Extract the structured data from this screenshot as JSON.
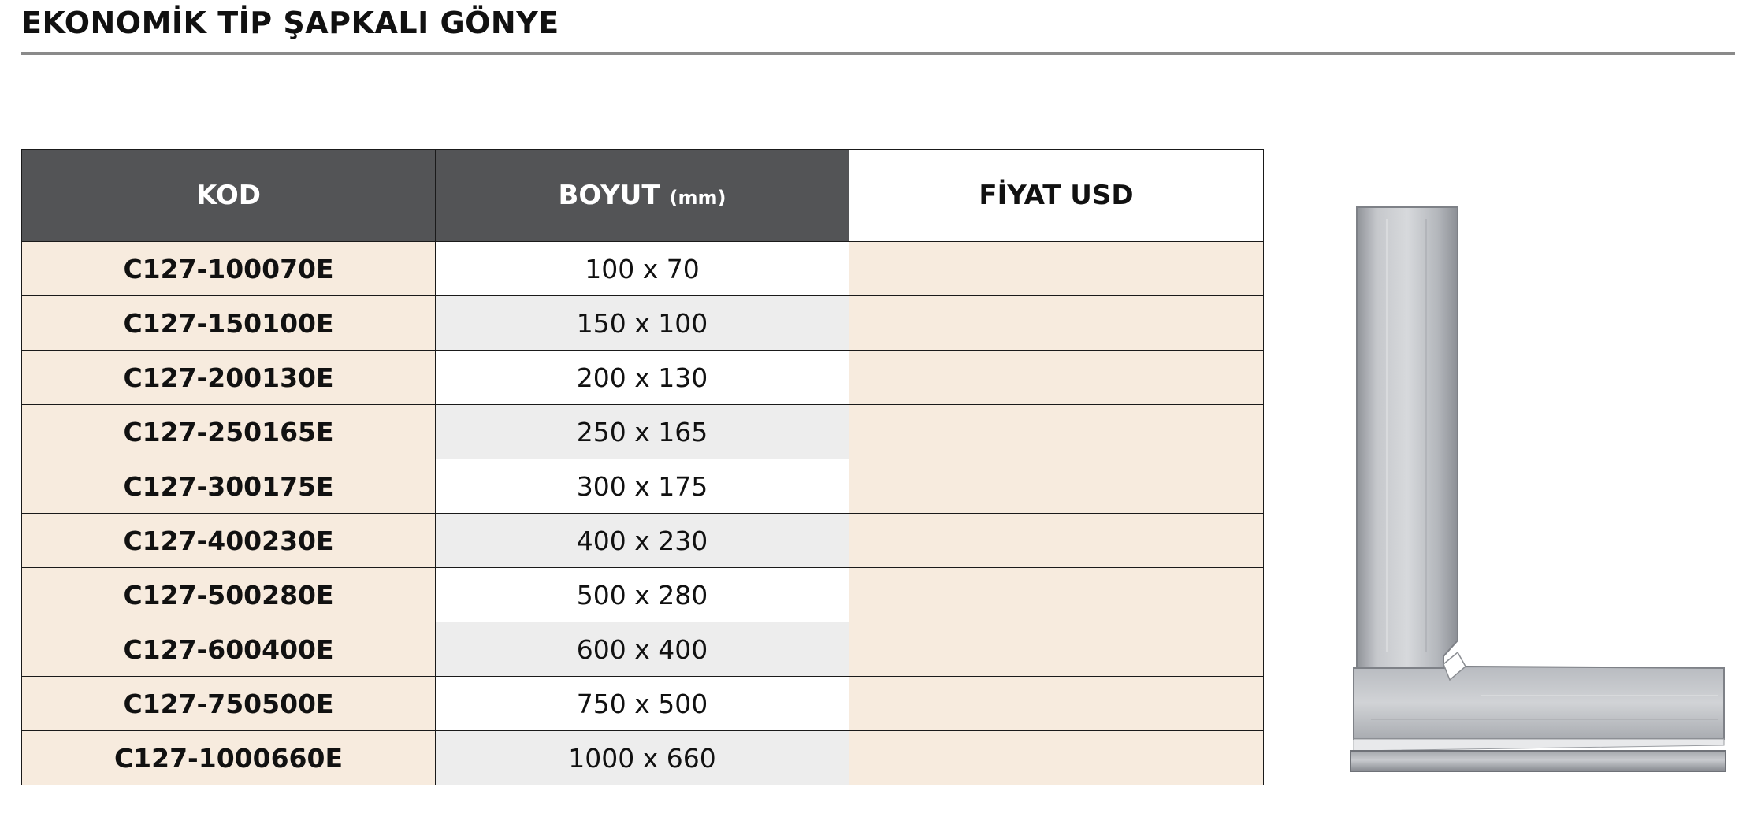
{
  "page_title": "EKONOMİK TİP ŞAPKALI GÖNYE",
  "table": {
    "headers": {
      "kod": "KOD",
      "boyut": "BOYUT",
      "boyut_unit": "(mm)",
      "fiyat": "FİYAT USD"
    },
    "rows": [
      {
        "kod": "C127-100070E",
        "boyut": "100 x 70",
        "fiyat": ""
      },
      {
        "kod": "C127-150100E",
        "boyut": "150 x 100",
        "fiyat": ""
      },
      {
        "kod": "C127-200130E",
        "boyut": "200 x 130",
        "fiyat": ""
      },
      {
        "kod": "C127-250165E",
        "boyut": "250 x 165",
        "fiyat": ""
      },
      {
        "kod": "C127-300175E",
        "boyut": "300 x 175",
        "fiyat": ""
      },
      {
        "kod": "C127-400230E",
        "boyut": "400 x 230",
        "fiyat": ""
      },
      {
        "kod": "C127-500280E",
        "boyut": "500 x 280",
        "fiyat": ""
      },
      {
        "kod": "C127-600400E",
        "boyut": "600 x 400",
        "fiyat": ""
      },
      {
        "kod": "C127-750500E",
        "boyut": "750 x 500",
        "fiyat": ""
      },
      {
        "kod": "C127-1000660E",
        "boyut": "1000 x 660",
        "fiyat": ""
      }
    ]
  },
  "colors": {
    "header_dark": "#535456",
    "row_beige": "#f7ebde",
    "row_grey": "#ededed",
    "rule": "#8a8a8a"
  },
  "image": {
    "icon": "try-square-icon"
  }
}
